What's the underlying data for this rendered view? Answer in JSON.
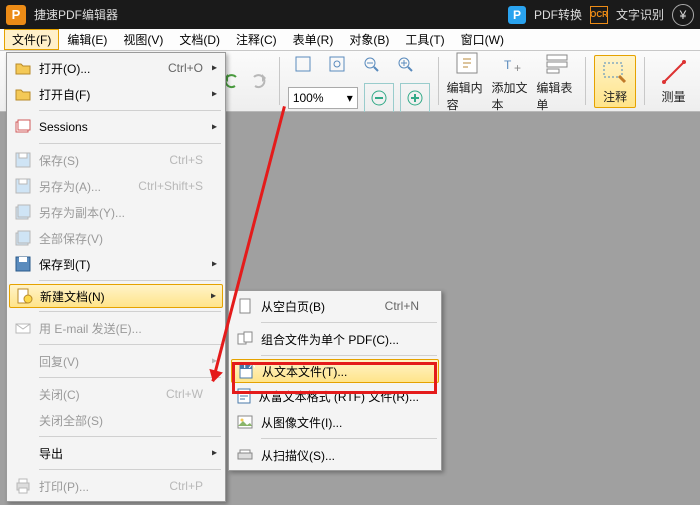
{
  "title": "捷速PDF编辑器",
  "titlebar": {
    "pdf_convert": "PDF转换",
    "ocr": "文字识别"
  },
  "menubar": [
    "文件(F)",
    "编辑(E)",
    "视图(V)",
    "文档(D)",
    "注释(C)",
    "表单(R)",
    "对象(B)",
    "工具(T)",
    "窗口(W)"
  ],
  "toolbar": {
    "zoom": "100%",
    "big": [
      "编辑内容",
      "添加文本",
      "编辑表单",
      "注释",
      "测量"
    ]
  },
  "file_menu": {
    "open": {
      "label": "打开(O)...",
      "sc": "Ctrl+O"
    },
    "open_from": {
      "label": "打开自(F)"
    },
    "sessions": {
      "label": "Sessions"
    },
    "save": {
      "label": "保存(S)",
      "sc": "Ctrl+S"
    },
    "save_as": {
      "label": "另存为(A)...",
      "sc": "Ctrl+Shift+S"
    },
    "save_copy": {
      "label": "另存为副本(Y)..."
    },
    "save_all": {
      "label": "全部保存(V)"
    },
    "save_to": {
      "label": "保存到(T)"
    },
    "new_doc": {
      "label": "新建文档(N)"
    },
    "email": {
      "label": "用 E-mail 发送(E)..."
    },
    "revert": {
      "label": "回复(V)"
    },
    "close": {
      "label": "关闭(C)",
      "sc": "Ctrl+W"
    },
    "close_all": {
      "label": "关闭全部(S)"
    },
    "export": {
      "label": "导出"
    },
    "print": {
      "label": "打印(P)...",
      "sc": "Ctrl+P"
    }
  },
  "sub_menu": {
    "blank": {
      "label": "从空白页(B)",
      "sc": "Ctrl+N"
    },
    "combine": {
      "label": "组合文件为单个 PDF(C)..."
    },
    "from_text": {
      "label": "从文本文件(T)..."
    },
    "from_rtf": {
      "label": "从富文本格式 (RTF) 文件(R)..."
    },
    "from_image": {
      "label": "从图像文件(I)..."
    },
    "from_scan": {
      "label": "从扫描仪(S)..."
    }
  }
}
